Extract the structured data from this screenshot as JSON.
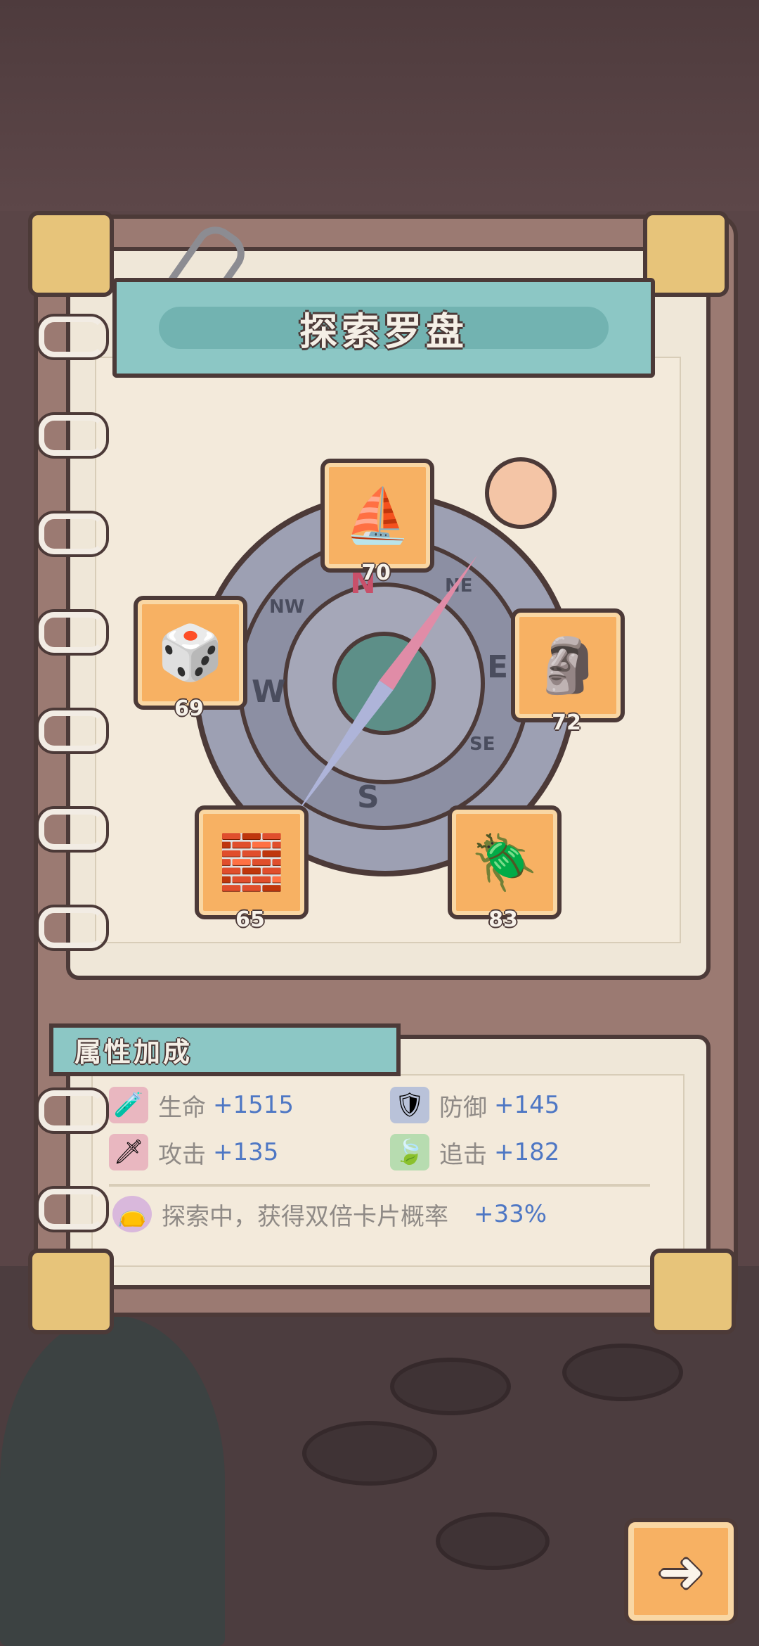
{
  "header": {
    "title": "探索罗盘"
  },
  "compass": {
    "n": "N",
    "s": "S",
    "e": "E",
    "w": "W",
    "nw": "NW",
    "ne": "NE",
    "se": "SE"
  },
  "items": [
    {
      "name": "ship",
      "icon": "⛵",
      "count": "70"
    },
    {
      "name": "gem-sack",
      "icon": "🎲",
      "count": "69"
    },
    {
      "name": "statue",
      "icon": "🗿",
      "count": "72"
    },
    {
      "name": "stone-tablet",
      "icon": "🧱",
      "count": "65"
    },
    {
      "name": "beetle",
      "icon": "🪲",
      "count": "83"
    }
  ],
  "bonus": {
    "title": "属性加成",
    "stats": [
      {
        "icon": "🧪",
        "label": "生命",
        "value": "+1515"
      },
      {
        "icon": "🛡",
        "label": "防御",
        "value": "+145"
      },
      {
        "icon": "🗡",
        "label": "攻击",
        "value": "+135"
      },
      {
        "icon": "🍃",
        "label": "追击",
        "value": "+182"
      }
    ],
    "extra": {
      "icon": "👝",
      "label": "探索中，获得双倍卡片概率",
      "value": "+33%"
    }
  },
  "next_button": {
    "icon": "➜"
  },
  "colors": {
    "tile": "#f7b163",
    "banner": "#8cc7c5",
    "stat_value": "#4e77c4"
  }
}
